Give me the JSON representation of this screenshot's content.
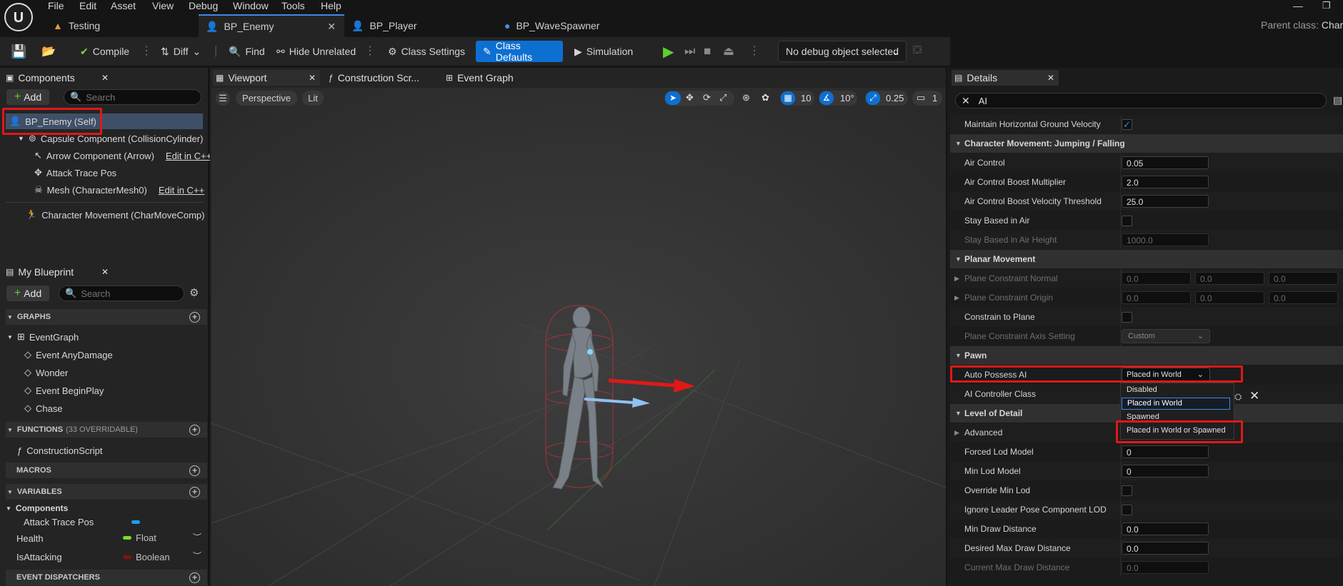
{
  "menu": [
    "File",
    "Edit",
    "Asset",
    "View",
    "Debug",
    "Window",
    "Tools",
    "Help"
  ],
  "doc_tabs": [
    {
      "label": "Testing"
    },
    {
      "label": "BP_Enemy"
    },
    {
      "label": "BP_Player"
    },
    {
      "label": "BP_WaveSpawner"
    }
  ],
  "parent_class_label": "Parent class:",
  "parent_class_value": "Chara",
  "toolbar": {
    "compile": "Compile",
    "diff": "Diff",
    "find": "Find",
    "hide_unrelated": "Hide Unrelated",
    "class_settings": "Class Settings",
    "class_defaults": "Class Defaults",
    "simulation": "Simulation",
    "debug_object": "No debug object selected"
  },
  "components": {
    "tab": "Components",
    "add": "Add",
    "search_placeholder": "Search",
    "items": [
      {
        "label": "BP_Enemy (Self)"
      },
      {
        "label": "Capsule Component (CollisionCylinder)"
      },
      {
        "label": "Arrow Component (Arrow)",
        "link": "Edit in C++"
      },
      {
        "label": "Attack Trace Pos"
      },
      {
        "label": "Mesh (CharacterMesh0)",
        "link": "Edit in C++"
      },
      {
        "label": "Character Movement (CharMoveComp)"
      }
    ]
  },
  "my_blueprint": {
    "tab": "My Blueprint",
    "add": "Add",
    "search_placeholder": "Search",
    "graphs_header": "GRAPHS",
    "event_graph": "EventGraph",
    "events": [
      "Event AnyDamage",
      "Wonder",
      "Event BeginPlay",
      "Chase"
    ],
    "functions_header": "FUNCTIONS",
    "functions_count": "(33 OVERRIDABLE)",
    "construction_script": "ConstructionScript",
    "macros_header": "MACROS",
    "variables_header": "VARIABLES",
    "components_group": "Components",
    "variables": [
      {
        "name": "Attack Trace Pos",
        "type": "",
        "color": "#1aa0f0"
      },
      {
        "name": "Health",
        "type": "Float",
        "color": "#7ddc2c"
      },
      {
        "name": "IsAttacking",
        "type": "Boolean",
        "color": "#8c0f0f"
      }
    ],
    "event_dispatchers_header": "EVENT DISPATCHERS"
  },
  "viewport_tabs": [
    "Viewport",
    "Construction Scr...",
    "Event Graph"
  ],
  "viewport": {
    "perspective": "Perspective",
    "lit": "Lit",
    "grid_snap": "10",
    "rot_snap": "10°",
    "scale_snap": "0.25",
    "cam_speed": "1"
  },
  "details": {
    "tab": "Details",
    "search_value": "AI",
    "rows": [
      {
        "kind": "check",
        "label": "Maintain Horizontal Ground Velocity",
        "checked": true
      },
      {
        "kind": "cat",
        "label": "Character Movement: Jumping / Falling"
      },
      {
        "kind": "num",
        "label": "Air Control",
        "value": "0.05"
      },
      {
        "kind": "num",
        "label": "Air Control Boost Multiplier",
        "value": "2.0"
      },
      {
        "kind": "num",
        "label": "Air Control Boost Velocity Threshold",
        "value": "25.0"
      },
      {
        "kind": "check",
        "label": "Stay Based in Air",
        "checked": false
      },
      {
        "kind": "numdim",
        "label": "Stay Based in Air Height",
        "value": "1000.0"
      },
      {
        "kind": "cat",
        "label": "Planar Movement"
      },
      {
        "kind": "vec",
        "label": "Plane Constraint Normal",
        "values": [
          "0.0",
          "0.0",
          "0.0"
        ]
      },
      {
        "kind": "vec",
        "label": "Plane Constraint Origin",
        "values": [
          "0.0",
          "0.0",
          "0.0"
        ]
      },
      {
        "kind": "check",
        "label": "Constrain to Plane",
        "checked": false
      },
      {
        "kind": "combo",
        "label": "Plane Constraint Axis Setting",
        "value": "Custom"
      },
      {
        "kind": "cat",
        "label": "Pawn"
      },
      {
        "kind": "combo2",
        "label": "Auto Possess AI",
        "value": "Placed in World"
      },
      {
        "kind": "plain",
        "label": "AI Controller Class"
      },
      {
        "kind": "cat",
        "label": "Level of Detail"
      },
      {
        "kind": "sub",
        "label": "Advanced"
      },
      {
        "kind": "num",
        "label": "Forced Lod Model",
        "value": "0"
      },
      {
        "kind": "num",
        "label": "Min Lod Model",
        "value": "0"
      },
      {
        "kind": "check",
        "label": "Override Min Lod",
        "checked": false
      },
      {
        "kind": "check",
        "label": "Ignore Leader Pose Component LOD",
        "checked": false
      },
      {
        "kind": "num",
        "label": "Min Draw Distance",
        "value": "0.0"
      },
      {
        "kind": "num",
        "label": "Desired Max Draw Distance",
        "value": "0.0"
      },
      {
        "kind": "numdim",
        "label": "Current Max Draw Distance",
        "value": "0.0"
      }
    ],
    "dropdown_options": [
      "Disabled",
      "Placed in World",
      "Spawned",
      "Placed in World or Spawned"
    ]
  },
  "colors": {
    "accent": "#0d6fd1",
    "highlight_red": "#e01818"
  }
}
